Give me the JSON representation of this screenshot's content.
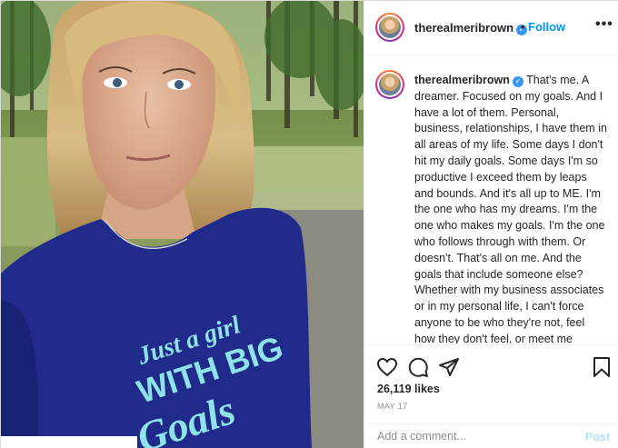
{
  "post": {
    "username": "therealmeribrown",
    "verified": true,
    "follow_separator": "•",
    "follow_label": "Follow",
    "more_label": "•••",
    "caption": "That's me. A dreamer. Focused on my goals. And I have a lot of them. Personal, business, relationships, I have them in all areas of my life. Some days I don't hit my daily goals. Some days I'm so productive I exceed them by leaps and bounds. And it's all up to ME. I'm the one who has my dreams. I'm the one who makes my goals. I'm the one who follows through with them. Or doesn't. That's all on me. And the goals that include someone else? Whether with my business associates or in my personal life, I can't force anyone to be who they're not, feel how they don't feel, or meet me anywhere they're not willing or able to meet me. And that's ok. I'll be here for them when they are. I can only control me.",
    "likes": "26,119 likes",
    "date": "MAY 17",
    "comment_placeholder": "Add a comment...",
    "post_label": "Post"
  },
  "photo": {
    "shirt_text_line1": "Just a girl",
    "shirt_text_line2": "WITH BIG",
    "shirt_text_line3": "Goals"
  },
  "icons": {
    "like": "heart-icon",
    "comment": "comment-icon",
    "share": "share-icon",
    "save": "bookmark-icon"
  },
  "colors": {
    "accent": "#0095f6",
    "verified": "#3897f0",
    "post_disabled": "#b2dffc",
    "shirt": "#1f2a8a",
    "shirt_print": "#8fe3e8"
  }
}
